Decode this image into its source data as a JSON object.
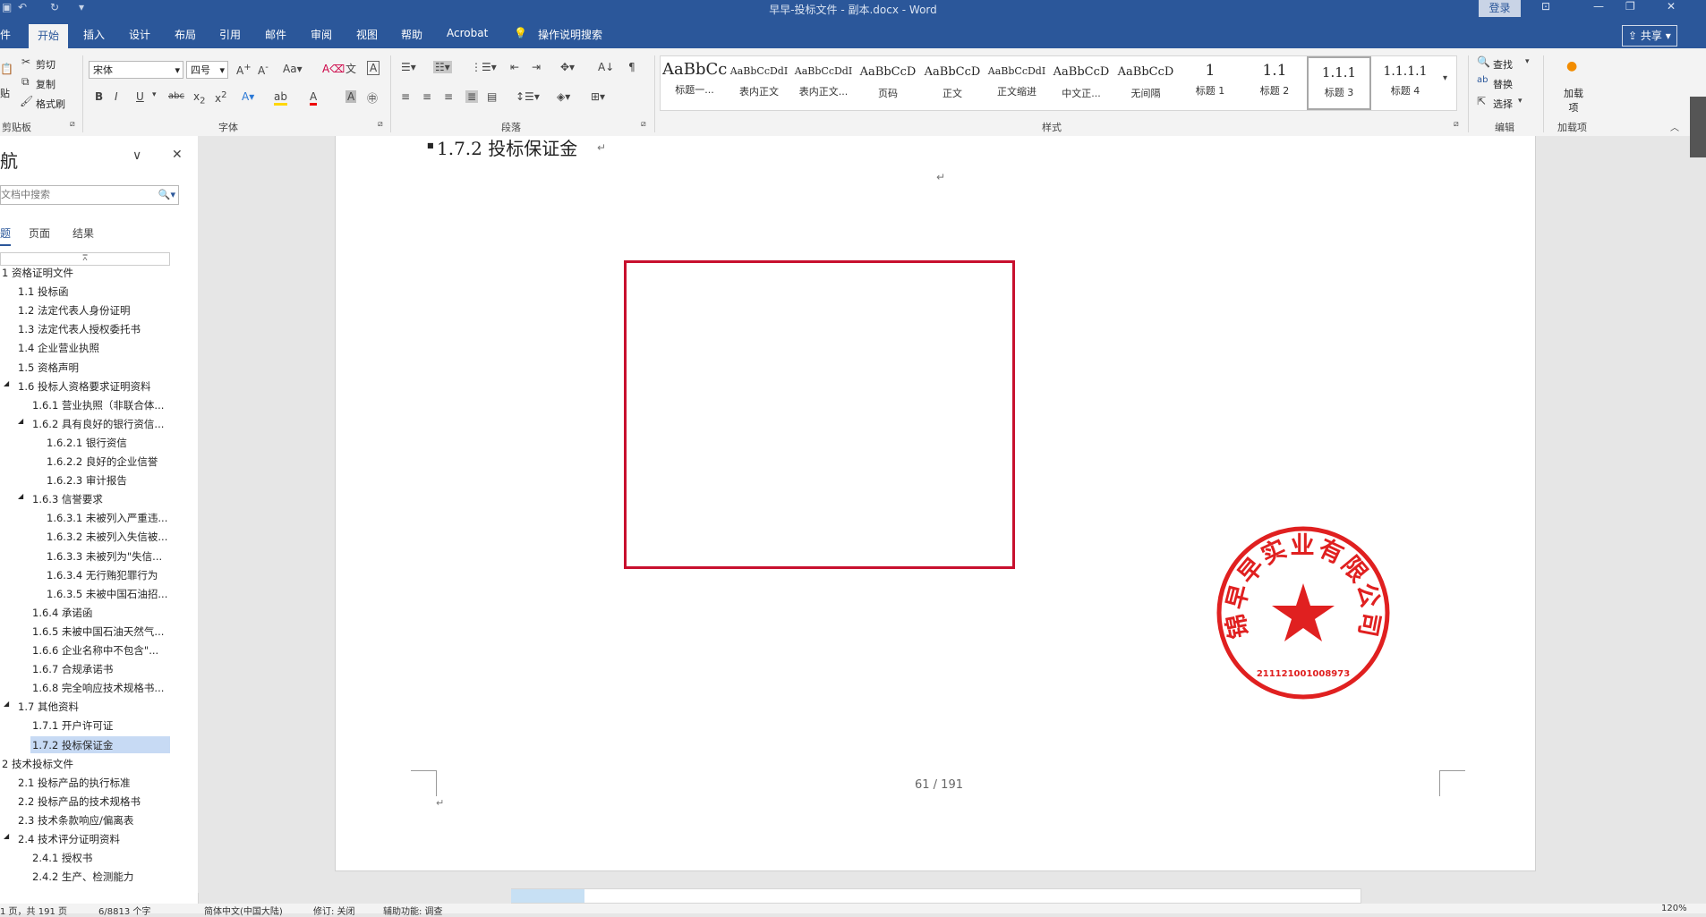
{
  "titlebar": {
    "title": "早早-投标文件 - 副本.docx  -  Word",
    "login": "登录",
    "undo_icon": "undo-icon",
    "redo_icon": "redo-icon"
  },
  "tabs": [
    "件",
    "开始",
    "插入",
    "设计",
    "布局",
    "引用",
    "邮件",
    "审阅",
    "视图",
    "帮助",
    "Acrobat"
  ],
  "tell_me": "操作说明搜索",
  "share": "共享",
  "ribbon": {
    "clipboard": {
      "paste": "贴",
      "cut": "剪切",
      "copy": "复制",
      "format_painter": "格式刷",
      "group": "剪贴板"
    },
    "font": {
      "name": "宋体",
      "size": "四号",
      "group": "字体"
    },
    "paragraph": {
      "group": "段落"
    },
    "styles": {
      "group": "样式",
      "items": [
        {
          "preview": "AaBbCc",
          "name": "标题一..."
        },
        {
          "preview": "AaBbCcDdI",
          "name": "表内正文"
        },
        {
          "preview": "AaBbCcDdI",
          "name": "表内正文..."
        },
        {
          "preview": "AaBbCcD",
          "name": "页码"
        },
        {
          "preview": "AaBbCcD",
          "name": "正文"
        },
        {
          "preview": "AaBbCcDdI",
          "name": "正文缩进"
        },
        {
          "preview": "AaBbCcD",
          "name": "中文正..."
        },
        {
          "preview": "AaBbCcD",
          "name": "无间隔"
        },
        {
          "preview": "1",
          "name": "标题 1"
        },
        {
          "preview": "1.1",
          "name": "标题 2"
        },
        {
          "preview": "1.1.1",
          "name": "标题 3"
        },
        {
          "preview": "1.1.1.1",
          "name": "标题 4"
        }
      ]
    },
    "editing": {
      "find": "查找",
      "replace": "替换",
      "select": "选择",
      "group": "编辑"
    },
    "addins": {
      "label": "加载项",
      "group": "加载项"
    }
  },
  "nav": {
    "title": "航",
    "search_placeholder": "文档中搜索",
    "tabs": [
      "题",
      "页面",
      "结果"
    ],
    "items": [
      "1 资格证明文件",
      "1.1 投标函",
      "1.2 法定代表人身份证明",
      "1.3 法定代表人授权委托书",
      "1.4 企业营业执照",
      "1.5 资格声明",
      "1.6 投标人资格要求证明资料",
      "1.6.1 营业执照（非联合体...",
      "1.6.2 具有良好的银行资信...",
      "1.6.2.1 银行资信",
      "1.6.2.2 良好的企业信誉",
      "1.6.2.3 审计报告",
      "1.6.3 信誉要求",
      "1.6.3.1 未被列入严重违...",
      "1.6.3.2 未被列入失信被...",
      "1.6.3.3 未被列为\"失信...",
      "1.6.3.4 无行贿犯罪行为",
      "1.6.3.5 未被中国石油招...",
      "1.6.4 承诺函",
      "1.6.5 未被中国石油天然气...",
      "1.6.6 企业名称中不包含\"...",
      "1.6.7 合规承诺书",
      "1.6.8 完全响应技术规格书...",
      "1.7 其他资料",
      "1.7.1 开户许可证",
      "1.7.2 投标保证金",
      "2 技术投标文件",
      "2.1 投标产品的执行标准",
      "2.2 投标产品的技术规格书",
      "2.3 技术条款响应/偏离表",
      "2.4 技术评分证明资料",
      "2.4.1 授权书",
      "2.4.2 生产、检测能力"
    ]
  },
  "document": {
    "heading": "1.7.2  投标保证金",
    "page_number": "61 / 191",
    "stamp_text": "锦早早实业有限公司",
    "stamp_code": "211121001008973"
  },
  "status": {
    "page": "1 页，共 191 页",
    "words": "6/8813 个字",
    "lang": "简体中文(中国大陆)",
    "track": "修订: 关闭",
    "access": "辅助功能: 调查",
    "zoom": "120%"
  }
}
